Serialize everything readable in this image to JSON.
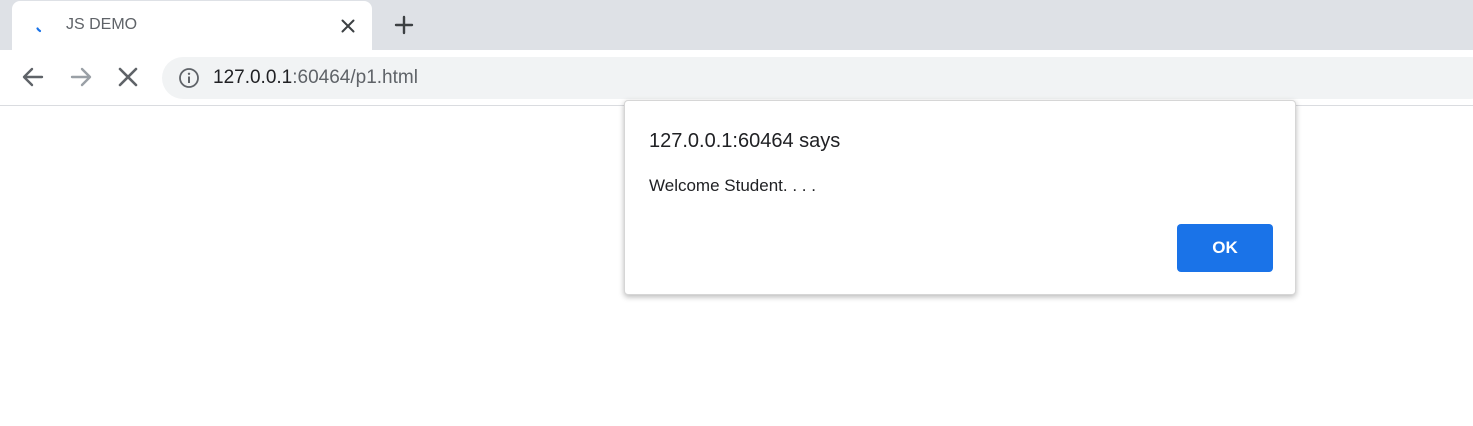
{
  "browser": {
    "tab": {
      "title": "JS DEMO",
      "favicon_icon": "loading-spinner-icon",
      "close_icon": "close-icon"
    },
    "new_tab_icon": "plus-icon",
    "toolbar": {
      "back_icon": "arrow-left-icon",
      "forward_icon": "arrow-right-icon",
      "stop_icon": "close-icon",
      "info_icon": "info-icon"
    },
    "address_bar": {
      "host": "127.0.0.1",
      "path": ":60464/p1.html"
    }
  },
  "dialog": {
    "title": "127.0.0.1:60464 says",
    "message": "Welcome Student. . . .",
    "ok_label": "OK"
  },
  "colors": {
    "tabstrip_bg": "#dee1e6",
    "omnibox_bg": "#f1f3f4",
    "accent_blue": "#1a73e8",
    "spinner": "#1a73e8",
    "icon_gray": "#5f6368",
    "disabled_gray": "#9aa0a6"
  }
}
